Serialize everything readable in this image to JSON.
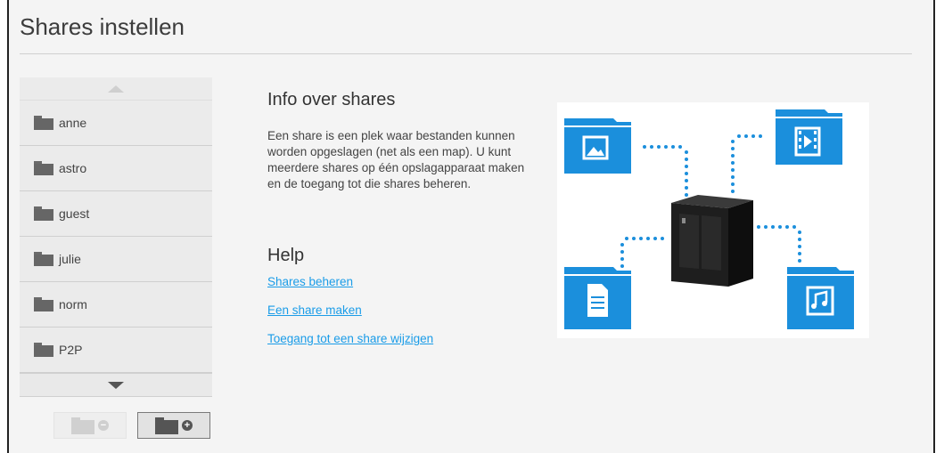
{
  "page": {
    "title": "Shares instellen"
  },
  "shares": {
    "items": [
      {
        "label": "anne"
      },
      {
        "label": "astro"
      },
      {
        "label": "guest"
      },
      {
        "label": "julie"
      },
      {
        "label": "norm"
      },
      {
        "label": "P2P"
      }
    ]
  },
  "info": {
    "title": "Info over shares",
    "text": "Een share is een plek waar bestanden kunnen worden opgeslagen (net als een map). U kunt meerdere shares op één opslagapparaat maken en de toegang tot die shares beheren."
  },
  "help": {
    "title": "Help",
    "links": [
      {
        "label": "Shares beheren"
      },
      {
        "label": "Een share maken"
      },
      {
        "label": "Toegang tot een share wijzigen"
      }
    ]
  },
  "colors": {
    "accent": "#1a9ce8",
    "folder_blue": "#1b8fdc"
  }
}
